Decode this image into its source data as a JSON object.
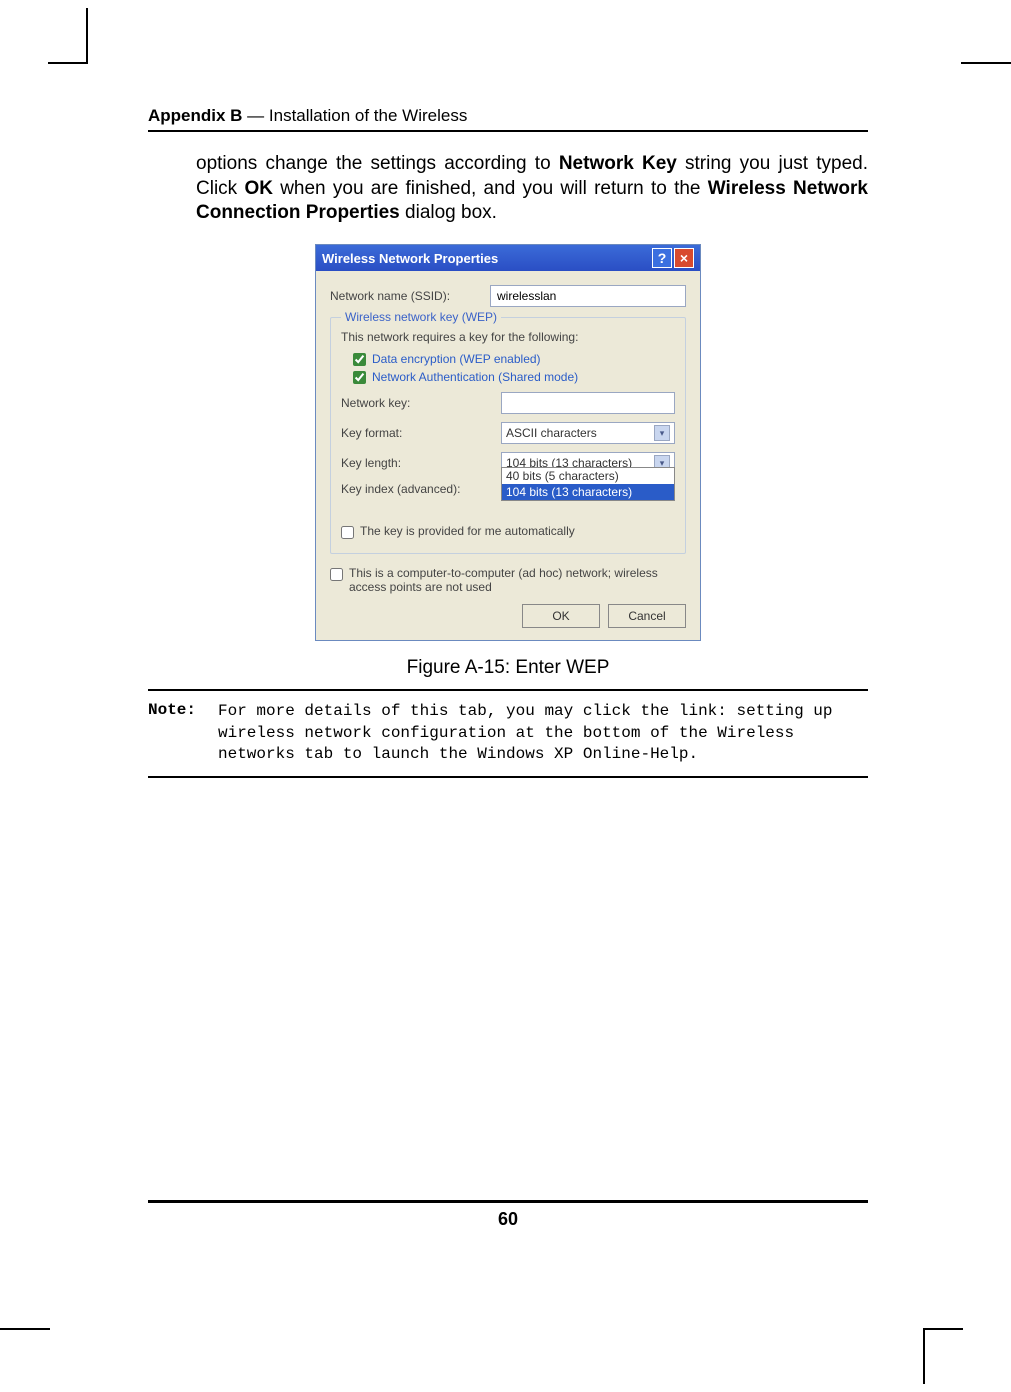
{
  "header": {
    "bold": "Appendix B",
    "rest": " — Installation of the Wireless"
  },
  "paragraph": {
    "pre": "options change the settings according to ",
    "b1": "Network Key",
    "mid1": " string you just typed. Click ",
    "b2": "OK",
    "mid2": " when you are finished, and you will return to the ",
    "b3": "Wireless Network Connection Properties",
    "post": " dialog box."
  },
  "dialog": {
    "title": "Wireless Network Properties",
    "help": "?",
    "close": "×",
    "ssid_label": "Network name (SSID):",
    "ssid_value": "wirelesslan",
    "fieldset_legend": "Wireless network key (WEP)",
    "requires": "This network requires a key for the following:",
    "data_enc": "Data encryption (WEP enabled)",
    "net_auth": "Network Authentication (Shared mode)",
    "netkey_label": "Network key:",
    "netkey_value": "",
    "keyformat_label": "Key format:",
    "keyformat_value": "ASCII characters",
    "keylength_label": "Key length:",
    "keylength_value": "104 bits (13 characters)",
    "keyindex_label": "Key index (advanced):",
    "keyindex_opts": [
      "40 bits (5 characters)",
      "104 bits (13 characters)"
    ],
    "auto_key": "The key is provided for me automatically",
    "adhoc": "This is a computer-to-computer (ad hoc) network; wireless access points are not used",
    "ok": "OK",
    "cancel": "Cancel"
  },
  "figure_caption": "Figure A-15: Enter WEP",
  "note": {
    "label": "Note:",
    "text": "For more details of this tab, you may click the link: setting up wireless network configuration at the bottom of the Wireless networks tab to launch the Windows XP Online-Help."
  },
  "page_number": "60"
}
